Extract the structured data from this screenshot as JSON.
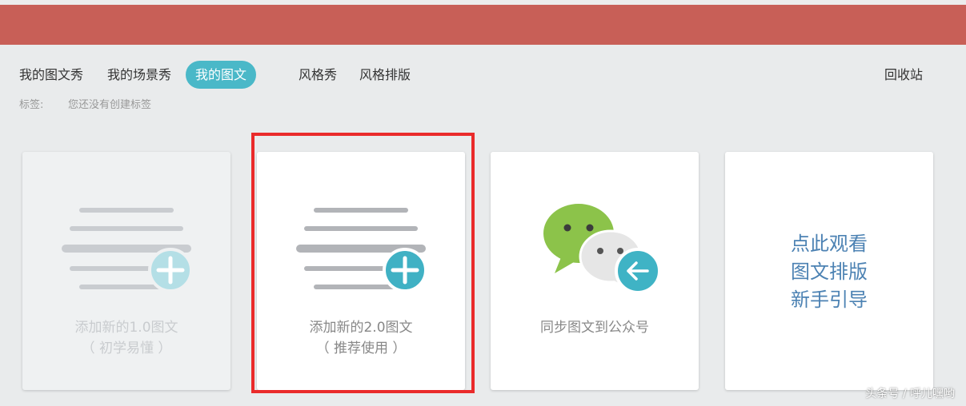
{
  "header": {
    "tabs": [
      {
        "label": "我的图文秀"
      },
      {
        "label": "我的场景秀"
      },
      {
        "label": "我的图文",
        "active": true
      },
      {
        "label": "风格秀"
      },
      {
        "label": "风格排版"
      }
    ],
    "recycle_label": "回收站",
    "accent_color": "#4ab8c8",
    "bar_color": "#c85f57"
  },
  "tags": {
    "label": "标签:",
    "empty_text": "您还没有创建标签"
  },
  "cards": [
    {
      "line1": "添加新的1.0图文",
      "line2": "（ 初学易懂 ）",
      "icon": "document-add-icon"
    },
    {
      "line1": "添加新的2.0图文",
      "line2": "（ 推荐使用 ）",
      "icon": "document-add-icon"
    },
    {
      "line1": "同步图文到公众号",
      "icon": "wechat-sync-icon"
    },
    {
      "guide_lines": [
        "点此观看",
        "图文排版",
        "新手引导"
      ]
    }
  ],
  "watermark": "头条号 / 呼儿嘿哟"
}
